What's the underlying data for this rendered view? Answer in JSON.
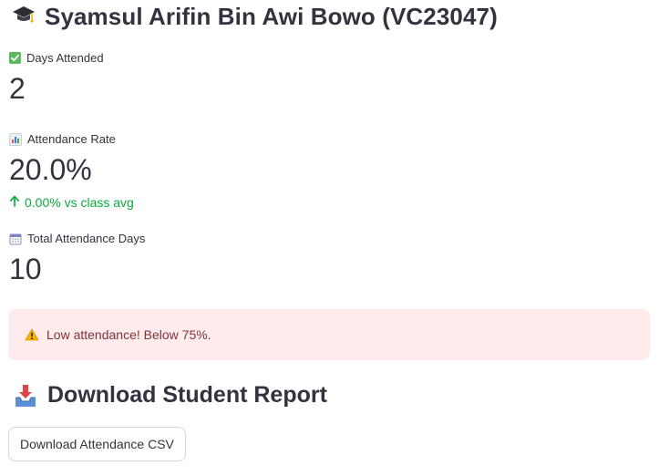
{
  "header": {
    "icon": "graduation-cap-icon",
    "title": "Syamsul Arifin Bin Awi Bowo (VC23047)"
  },
  "metrics": [
    {
      "icon": "check-mark-icon",
      "label": "Days Attended",
      "value": "2"
    },
    {
      "icon": "bar-chart-icon",
      "label": "Attendance Rate",
      "value": "20.0%",
      "delta": "0.00% vs class avg",
      "delta_direction": "up",
      "delta_color": "#09ab3b"
    },
    {
      "icon": "calendar-icon",
      "label": "Total Attendance Days",
      "value": "10"
    }
  ],
  "alert": {
    "icon": "warning-icon",
    "text": "Low attendance! Below 75%.",
    "background": "#ffebeb",
    "text_color": "#7d353b"
  },
  "download": {
    "icon": "inbox-tray-icon",
    "heading": "Download Student Report",
    "button_label": "Download Attendance CSV"
  }
}
